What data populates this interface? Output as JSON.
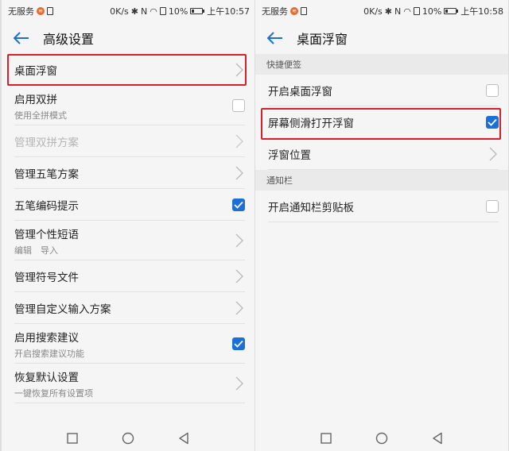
{
  "colors": {
    "accent": "#1a6fd8",
    "highlight": "#d6202e"
  },
  "left": {
    "status": {
      "carrier": "无服务",
      "speed": "0K/s",
      "battery": "10%",
      "time": "上午10:57"
    },
    "title": "高级设置",
    "items": [
      {
        "label": "桌面浮窗",
        "control": "chevron"
      },
      {
        "label": "启用双拼",
        "sub": "使用全拼模式",
        "control": "checkbox",
        "checked": false
      },
      {
        "label": "管理双拼方案",
        "control": "chevron",
        "disabled": true
      },
      {
        "label": "管理五笔方案",
        "control": "chevron"
      },
      {
        "label": "五笔编码提示",
        "control": "checkbox",
        "checked": true
      },
      {
        "label": "管理个性短语",
        "sub": "编辑　导入",
        "control": "chevron"
      },
      {
        "label": "管理符号文件",
        "control": "chevron"
      },
      {
        "label": "管理自定义输入方案",
        "control": "chevron"
      },
      {
        "label": "启用搜索建议",
        "sub": "开启搜索建议功能",
        "control": "checkbox",
        "checked": true
      },
      {
        "label": "恢复默认设置",
        "sub": "一键恢复所有设置项",
        "control": "chevron"
      }
    ]
  },
  "right": {
    "status": {
      "carrier": "无服务",
      "speed": "0K/s",
      "battery": "10%",
      "time": "上午10:58"
    },
    "title": "桌面浮窗",
    "section1": "快捷便签",
    "items1": [
      {
        "label": "开启桌面浮窗",
        "control": "checkbox",
        "checked": false
      },
      {
        "label": "屏幕侧滑打开浮窗",
        "control": "checkbox",
        "checked": true
      },
      {
        "label": "浮窗位置",
        "control": "chevron"
      }
    ],
    "section2": "通知栏",
    "items2": [
      {
        "label": "开启通知栏剪贴板",
        "control": "checkbox",
        "checked": false
      }
    ]
  }
}
